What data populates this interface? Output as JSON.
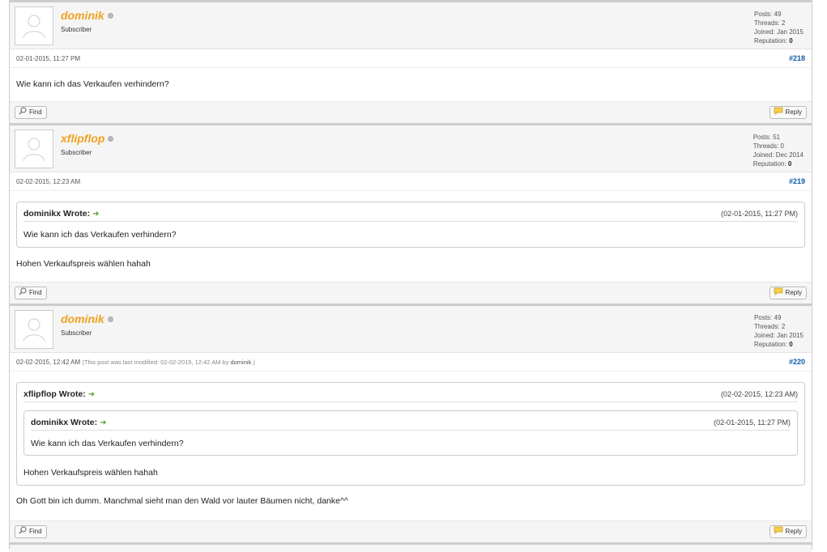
{
  "posts": [
    {
      "author": "dominik",
      "usertitle": "Subscriber",
      "stats": {
        "posts_label": "Posts:",
        "posts": "49",
        "threads_label": "Threads:",
        "threads": "2",
        "joined_label": "Joined:",
        "joined": "Jan 2015",
        "rep_label": "Reputation:",
        "rep": "0"
      },
      "date": "02-01-2015, 11:27 PM",
      "number": "#218",
      "message": "Wie kann ich das Verkaufen verhindern?"
    },
    {
      "author": "xflipflop",
      "usertitle": "Subscriber",
      "stats": {
        "posts_label": "Posts:",
        "posts": "51",
        "threads_label": "Threads:",
        "threads": "0",
        "joined_label": "Joined:",
        "joined": "Dec 2014",
        "rep_label": "Reputation:",
        "rep": "0"
      },
      "date": "02-02-2015, 12:23 AM",
      "number": "#219",
      "quote": {
        "who": "dominikx Wrote:",
        "date": "(02-01-2015, 11:27 PM)",
        "text": "Wie kann ich das Verkaufen verhindern?"
      },
      "message": "Hohen Verkaufspreis wählen hahah"
    },
    {
      "author": "dominik",
      "usertitle": "Subscriber",
      "stats": {
        "posts_label": "Posts:",
        "posts": "49",
        "threads_label": "Threads:",
        "threads": "2",
        "joined_label": "Joined:",
        "joined": "Jan 2015",
        "rep_label": "Reputation:",
        "rep": "0"
      },
      "date": "02-02-2015, 12:42 AM",
      "edited_prefix": "(This post was last modified: 02-02-2015, 12:42 AM by",
      "edited_by": "dominik",
      "edited_suffix": ".)",
      "number": "#220",
      "quote": {
        "who": "xflipflop Wrote:",
        "date": "(02-02-2015, 12:23 AM)",
        "inner": {
          "who": "dominikx Wrote:",
          "date": "(02-01-2015, 11:27 PM)",
          "text": "Wie kann ich das Verkaufen verhindern?"
        },
        "text": "Hohen Verkaufspreis wählen hahah"
      },
      "message": "Oh Gott bin ich dumm. Manchmal sieht man den Wald vor lauter Bäumen nicht, danke^^"
    }
  ],
  "buttons": {
    "find": "Find",
    "reply": "Reply"
  },
  "icons": {
    "quote_link": "arrow-right-icon",
    "find": "magnifier-icon",
    "reply": "speech-bubble-icon",
    "status": "offline-dot-icon",
    "avatar": "default-avatar-icon"
  },
  "colors": {
    "username": "#f0a11e",
    "post_number": "#0c5aa6",
    "arrow": "#5aa02c"
  }
}
